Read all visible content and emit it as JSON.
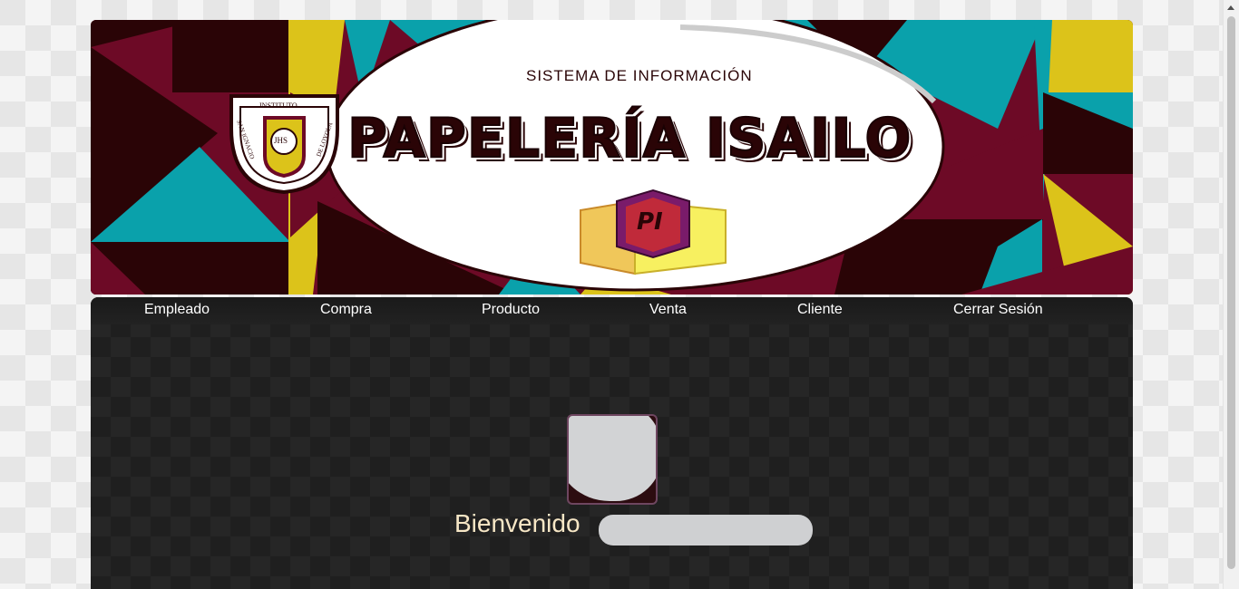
{
  "header": {
    "subtitle": "SISTEMA DE INFORMACIÓN",
    "title": "PAPELERÍA ISAILO",
    "book_monogram": "PI",
    "seal": {
      "top": "INSTITUTO",
      "left": "SAN IGNACIO",
      "right": "DE LOYOLA",
      "center": "JHS"
    }
  },
  "nav": {
    "items": [
      {
        "label": "Empleado"
      },
      {
        "label": "Compra"
      },
      {
        "label": "Producto"
      },
      {
        "label": "Venta"
      },
      {
        "label": "Cliente"
      },
      {
        "label": "Cerrar Sesión"
      }
    ]
  },
  "main": {
    "welcome_text": "Bienvenido"
  },
  "colors": {
    "maroon": "#6d0a26",
    "dark_maroon": "#2a0406",
    "teal": "#0aa1ab",
    "yellow": "#dcc31a",
    "content_bg": "#1f1f1f",
    "welcome_text": "#f7e7c6"
  }
}
